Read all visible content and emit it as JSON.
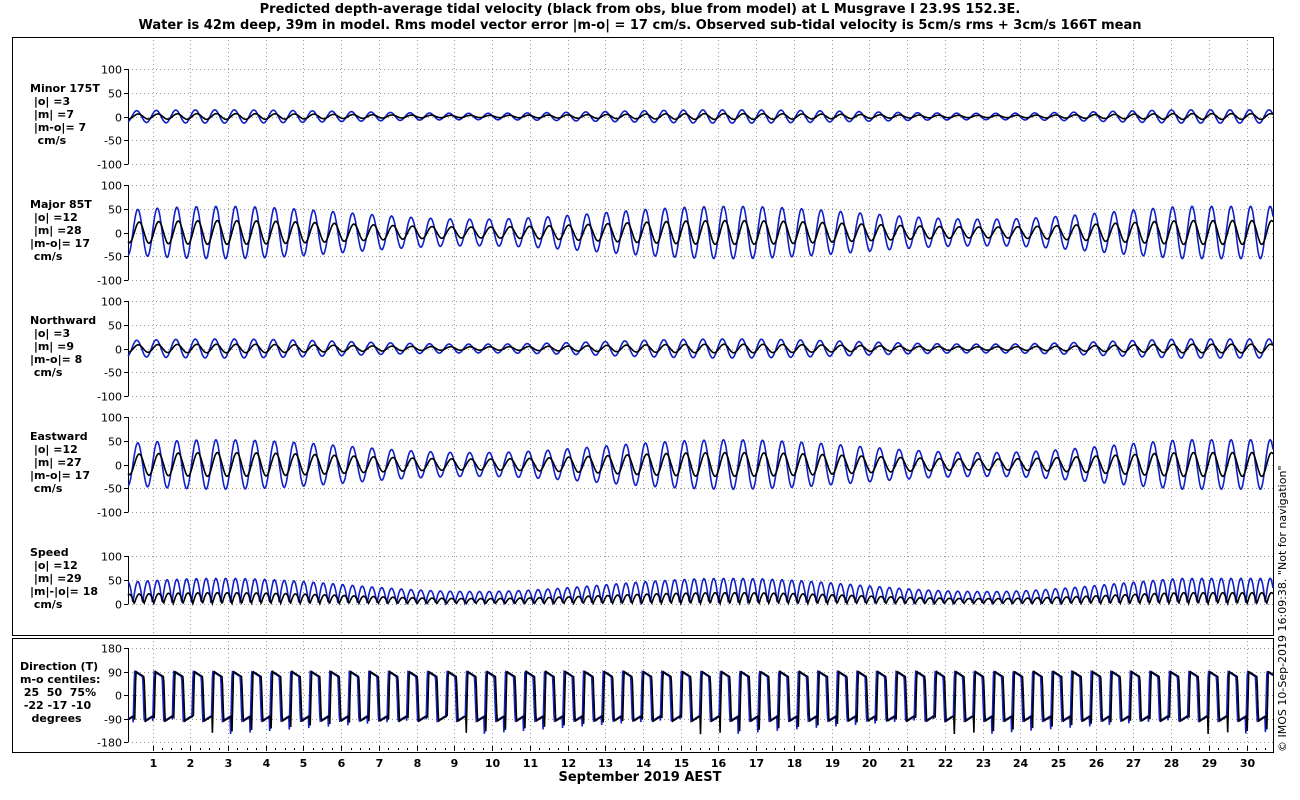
{
  "header": {
    "title_line1": "Predicted depth-average tidal velocity (black from obs, blue from model) at L Musgrave I 23.9S 152.3E.",
    "title_line2": "Water is 42m deep, 39m in model. Rms model vector error |m-o| = 17 cm/s. Observed sub-tidal velocity is 5cm/s rms + 3cm/s 166T mean"
  },
  "colors": {
    "observed": "#000000",
    "model": "#1020c8",
    "grid": "#9a9a9a"
  },
  "x_axis": {
    "label": "September 2019 AEST",
    "ticks": [
      "1",
      "2",
      "3",
      "4",
      "5",
      "6",
      "7",
      "8",
      "9",
      "10",
      "11",
      "12",
      "13",
      "14",
      "15",
      "16",
      "17",
      "18",
      "19",
      "20",
      "21",
      "22",
      "23",
      "24",
      "25",
      "26",
      "27",
      "28",
      "29",
      "30"
    ]
  },
  "credit": "© IMOS 10-Sep-2019 16:09:38. \"Not for navigation\"",
  "panels": [
    {
      "id": "minor",
      "label_lines": [
        "Minor 175T",
        " |o| =3",
        " |m| =7",
        " |m-o|= 7",
        "  cm/s"
      ],
      "yticks": [
        "100",
        "50",
        "0",
        "-50",
        "-100"
      ]
    },
    {
      "id": "major",
      "label_lines": [
        "Major 85T",
        " |o| =12",
        " |m| =28",
        "|m-o|= 17",
        " cm/s"
      ],
      "yticks": [
        "100",
        "50",
        "0",
        "-50",
        "-100"
      ]
    },
    {
      "id": "north",
      "label_lines": [
        "Northward",
        " |o| =3",
        " |m| =9",
        "|m-o|= 8",
        " cm/s"
      ],
      "yticks": [
        "100",
        "50",
        "0",
        "-50",
        "-100"
      ]
    },
    {
      "id": "east",
      "label_lines": [
        "Eastward",
        " |o| =12",
        " |m| =27",
        "|m-o|= 17",
        " cm/s"
      ],
      "yticks": [
        "100",
        "50",
        "0",
        "-50",
        "-100"
      ]
    },
    {
      "id": "speed",
      "label_lines": [
        "Speed",
        " |o| =12",
        " |m| =29",
        "|m|-|o|= 18",
        " cm/s"
      ],
      "yticks": [
        "100",
        "50",
        "0"
      ]
    },
    {
      "id": "dir",
      "label_lines": [
        "Direction (T)",
        "m-o centiles:",
        " 25  50  75%",
        " -22 -17 -10",
        "   degrees"
      ],
      "yticks": [
        "180",
        "90",
        "0",
        "-90",
        "-180"
      ]
    }
  ],
  "chart_data": {
    "type": "line",
    "x_unit": "day of September 2019 (AEST)",
    "xlim": [
      0.35,
      30.7
    ],
    "series": [
      {
        "name": "black from obs",
        "color": "#000000"
      },
      {
        "name": "blue from model",
        "color": "#1020c8"
      }
    ],
    "tide": {
      "m2_period_days": 0.5175,
      "spring_days": [
        2.8,
        13.8,
        27.8
      ],
      "neap_days": [
        8.0,
        21.0
      ]
    },
    "panels": [
      {
        "id": "minor",
        "ylim": [
          -100,
          100
        ],
        "obs_rms": 3,
        "model_rms": 7
      },
      {
        "id": "major",
        "ylim": [
          -100,
          100
        ],
        "obs_rms": 12,
        "model_rms": 28,
        "obs_amplitude_range": [
          10,
          25
        ],
        "model_amplitude_range": [
          25,
          55
        ]
      },
      {
        "id": "north",
        "ylim": [
          -100,
          100
        ],
        "obs_rms": 3,
        "model_rms": 9
      },
      {
        "id": "east",
        "ylim": [
          -100,
          100
        ],
        "obs_rms": 12,
        "model_rms": 27,
        "obs_amplitude_range": [
          10,
          25
        ],
        "model_amplitude_range": [
          20,
          52
        ]
      },
      {
        "id": "speed",
        "ylim": [
          0,
          100
        ],
        "obs_rms": 12,
        "model_rms": 29
      },
      {
        "id": "dir",
        "ylim": [
          -180,
          180
        ],
        "centiles_m_minus_o": {
          "25": -22,
          "50": -17,
          "75": -10
        }
      }
    ]
  }
}
